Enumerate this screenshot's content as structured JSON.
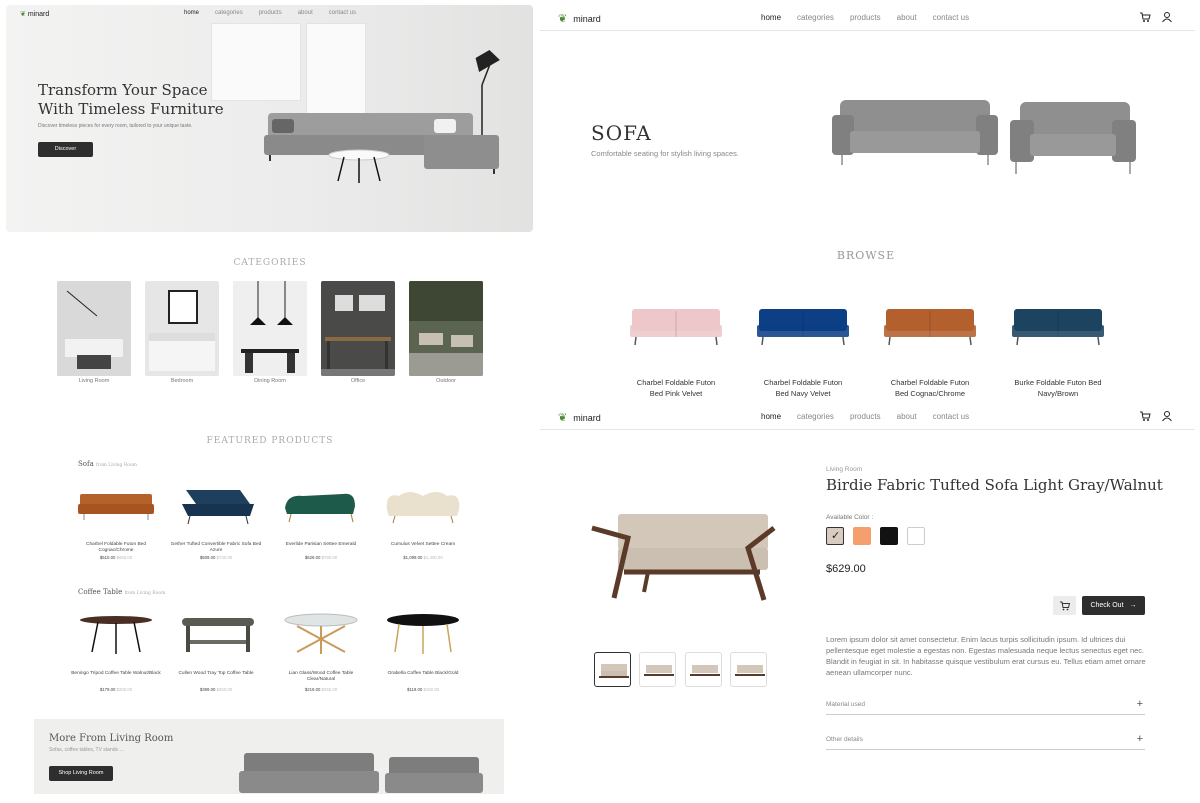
{
  "brand": "minard",
  "nav": {
    "links": [
      "home",
      "categories",
      "products",
      "about",
      "contact us"
    ]
  },
  "icons": {
    "cart": "cart-icon",
    "user": "user-icon",
    "logo": "plant-icon"
  },
  "hero": {
    "title_line1": "Transform Your Space",
    "title_line2": "With Timeless Furniture",
    "subtitle": "Discover timeless pieces for every room, tailored to your unique taste.",
    "button": "Discover"
  },
  "categories": {
    "title": "CATEGORIES",
    "items": [
      "Living Room",
      "Bedroom",
      "Dining Room",
      "Office",
      "Outdoor"
    ]
  },
  "featured": {
    "title": "FEATURED PRODUCTS",
    "groups": [
      {
        "name": "Sofa",
        "tag": "from Living Room",
        "products": [
          {
            "name": "Charbel Foldable Futon Bed Cognac/Chrome",
            "price": "$510.00",
            "old": "$650.00"
          },
          {
            "name": "Gether Tufted Convertible Fabric Sofa Bed Azure",
            "price": "$509.00",
            "old": "$730.00"
          },
          {
            "name": "Everlide Parisian Settee Emerald",
            "price": "$629.00",
            "old": "$790.00"
          },
          {
            "name": "Cumulus Velvet Settee Cream",
            "price": "$1,099.00",
            "old": "$1,400.00"
          }
        ]
      },
      {
        "name": "Coffee Table",
        "tag": "from Living Room",
        "products": [
          {
            "name": "Beningo Tripod Coffee Table Walnut/Black",
            "price": "$179.00",
            "old": "$200.00"
          },
          {
            "name": "Cullen Wood Tray Top Coffee Table",
            "price": "$399.00",
            "old": "$250.00"
          },
          {
            "name": "Lian Glass/Wood Coffee Table Clear/Natural",
            "price": "$219.00",
            "old": "$250.00"
          },
          {
            "name": "Orabella Coffee Table Black/Gold",
            "price": "$119.00",
            "old": "$150.00"
          }
        ]
      }
    ]
  },
  "banner": {
    "title": "More From Living Room",
    "subtitle": "Sofas, coffee tables, TV stands ...",
    "button": "Shop Living Room"
  },
  "category_page": {
    "title": "SOFA",
    "subtitle": "Comfortable seating for stylish living spaces.",
    "browse_title": "BROWSE",
    "items": [
      {
        "line1": "Charbel Foldable Futon",
        "line2": "Bed Pink Velvet",
        "color": "#edc7c9"
      },
      {
        "line1": "Charbel Foldable Futon",
        "line2": "Bed Navy Velvet",
        "color": "#0d3f86"
      },
      {
        "line1": "Charbel Foldable Futon",
        "line2": "Bed Cognac/Chrome",
        "color": "#b3602e"
      },
      {
        "line1": "Burke Foldable Futon Bed",
        "line2": "Navy/Brown",
        "color": "#1c4460"
      }
    ]
  },
  "product_page": {
    "breadcrumb": "Living Room",
    "title": "Birdie Fabric Tufted Sofa Light Gray/Walnut",
    "color_label": "Available Color :",
    "colors": [
      "#d8cbbf",
      "#f5a06c",
      "#121212",
      "#ffffff"
    ],
    "price": "$629.00",
    "checkout": "Check Out",
    "description": "Lorem ipsum dolor sit amet consectetur. Enim lacus turpis sollicitudin ipsum. Id ultrices dui pellentesque eget molestie a egestas non. Egestas malesuada neque lectus senectus eget nec. Blandit in feugiat in sit. In habitasse quisque vestibulum erat cursus eu. Tellus etiam amet ornare aenean ullamcorper nunc.",
    "accordions": [
      "Material used",
      "Other details"
    ]
  }
}
